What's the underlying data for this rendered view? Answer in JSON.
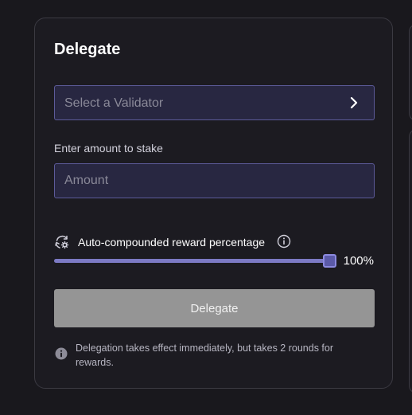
{
  "card": {
    "title": "Delegate"
  },
  "validator": {
    "placeholder": "Select a Validator",
    "chevron_icon": "chevron-right-icon"
  },
  "stake": {
    "label": "Enter amount to stake",
    "placeholder": "Amount",
    "value": ""
  },
  "compound": {
    "icon": "auto-compound-icon",
    "label": "Auto-compounded reward percentage",
    "info_icon": "info-icon",
    "percent": 100,
    "percent_label": "100%"
  },
  "delegate_button": {
    "label": "Delegate"
  },
  "note": {
    "icon": "info-filled-icon",
    "text": "Delegation takes effect immediately, but takes 2 rounds for rewards."
  },
  "colors": {
    "background": "#19181d",
    "input_background": "#282741",
    "input_border": "#5d5b9a",
    "slider_fill": "#7c7ac4",
    "button_disabled": "#959595"
  }
}
